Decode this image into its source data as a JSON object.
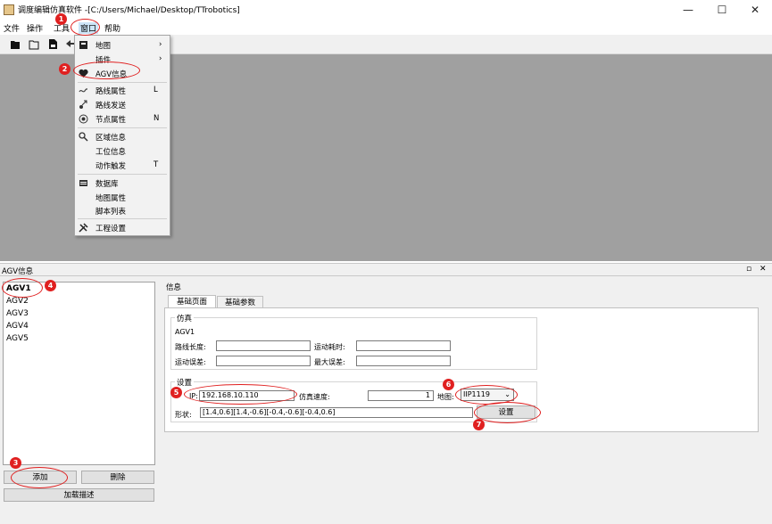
{
  "window": {
    "title": "调度编辑仿真软件 -[C:/Users/Michael/Desktop/TTrobotics]",
    "minimize": "—",
    "maximize": "☐",
    "close": "✕"
  },
  "menubar": {
    "items": [
      "文件",
      "操作",
      "工具",
      "窗口",
      "帮助"
    ]
  },
  "dropdown": {
    "items": [
      {
        "label": "地图",
        "icon": "map-icon",
        "shortcut": "",
        "arrow": "›"
      },
      {
        "label": "插件",
        "icon": "",
        "shortcut": "",
        "arrow": "›"
      },
      {
        "label": "AGV信息",
        "icon": "heart-icon",
        "shortcut": ""
      },
      {
        "label": "路线属性",
        "icon": "route-icon",
        "shortcut": "L"
      },
      {
        "label": "路线发送",
        "icon": "send-route-icon",
        "shortcut": ""
      },
      {
        "label": "节点属性",
        "icon": "node-icon",
        "shortcut": "N"
      },
      {
        "label": "区域信息",
        "icon": "area-icon",
        "shortcut": ""
      },
      {
        "label": "工位信息",
        "icon": "",
        "shortcut": ""
      },
      {
        "label": "动作触发",
        "icon": "",
        "shortcut": "T"
      },
      {
        "label": "数据库",
        "icon": "database-icon",
        "shortcut": ""
      },
      {
        "label": "地图属性",
        "icon": "",
        "shortcut": ""
      },
      {
        "label": "脚本列表",
        "icon": "",
        "shortcut": ""
      },
      {
        "label": "工程设置",
        "icon": "tools-icon",
        "shortcut": ""
      }
    ]
  },
  "dock": {
    "title": "AGV信息",
    "float_icon": "▫",
    "close_icon": "✕"
  },
  "agv_list": [
    "AGV1",
    "AGV2",
    "AGV3",
    "AGV4",
    "AGV5"
  ],
  "buttons": {
    "add": "添加",
    "delete": "删除",
    "load": "加载描述",
    "set": "设置"
  },
  "info": {
    "label": "信息",
    "tabs": [
      "基础页面",
      "基础参数"
    ],
    "sim_group": "仿真",
    "agv_name": "AGV1",
    "route_length_label": "路线长度:",
    "move_time_label": "运动耗时:",
    "move_error_label": "运动误差:",
    "max_error_label": "最大误差:",
    "settings_group": "设置",
    "ip_label": "IP:",
    "ip_value": "192.168.10.110",
    "sim_speed_label": "仿真速度:",
    "sim_speed_value": "1",
    "map_label": "地图:",
    "map_value": "IIP1119",
    "shape_label": "形状:",
    "shape_value": "[1.4,0.6][1.4,-0.6][-0.4,-0.6][-0.4,0.6]"
  },
  "annotations": [
    "1",
    "2",
    "3",
    "4",
    "5",
    "6",
    "7"
  ],
  "colors": {
    "annotation": "#e02020",
    "canvas": "#a0a0a0"
  }
}
